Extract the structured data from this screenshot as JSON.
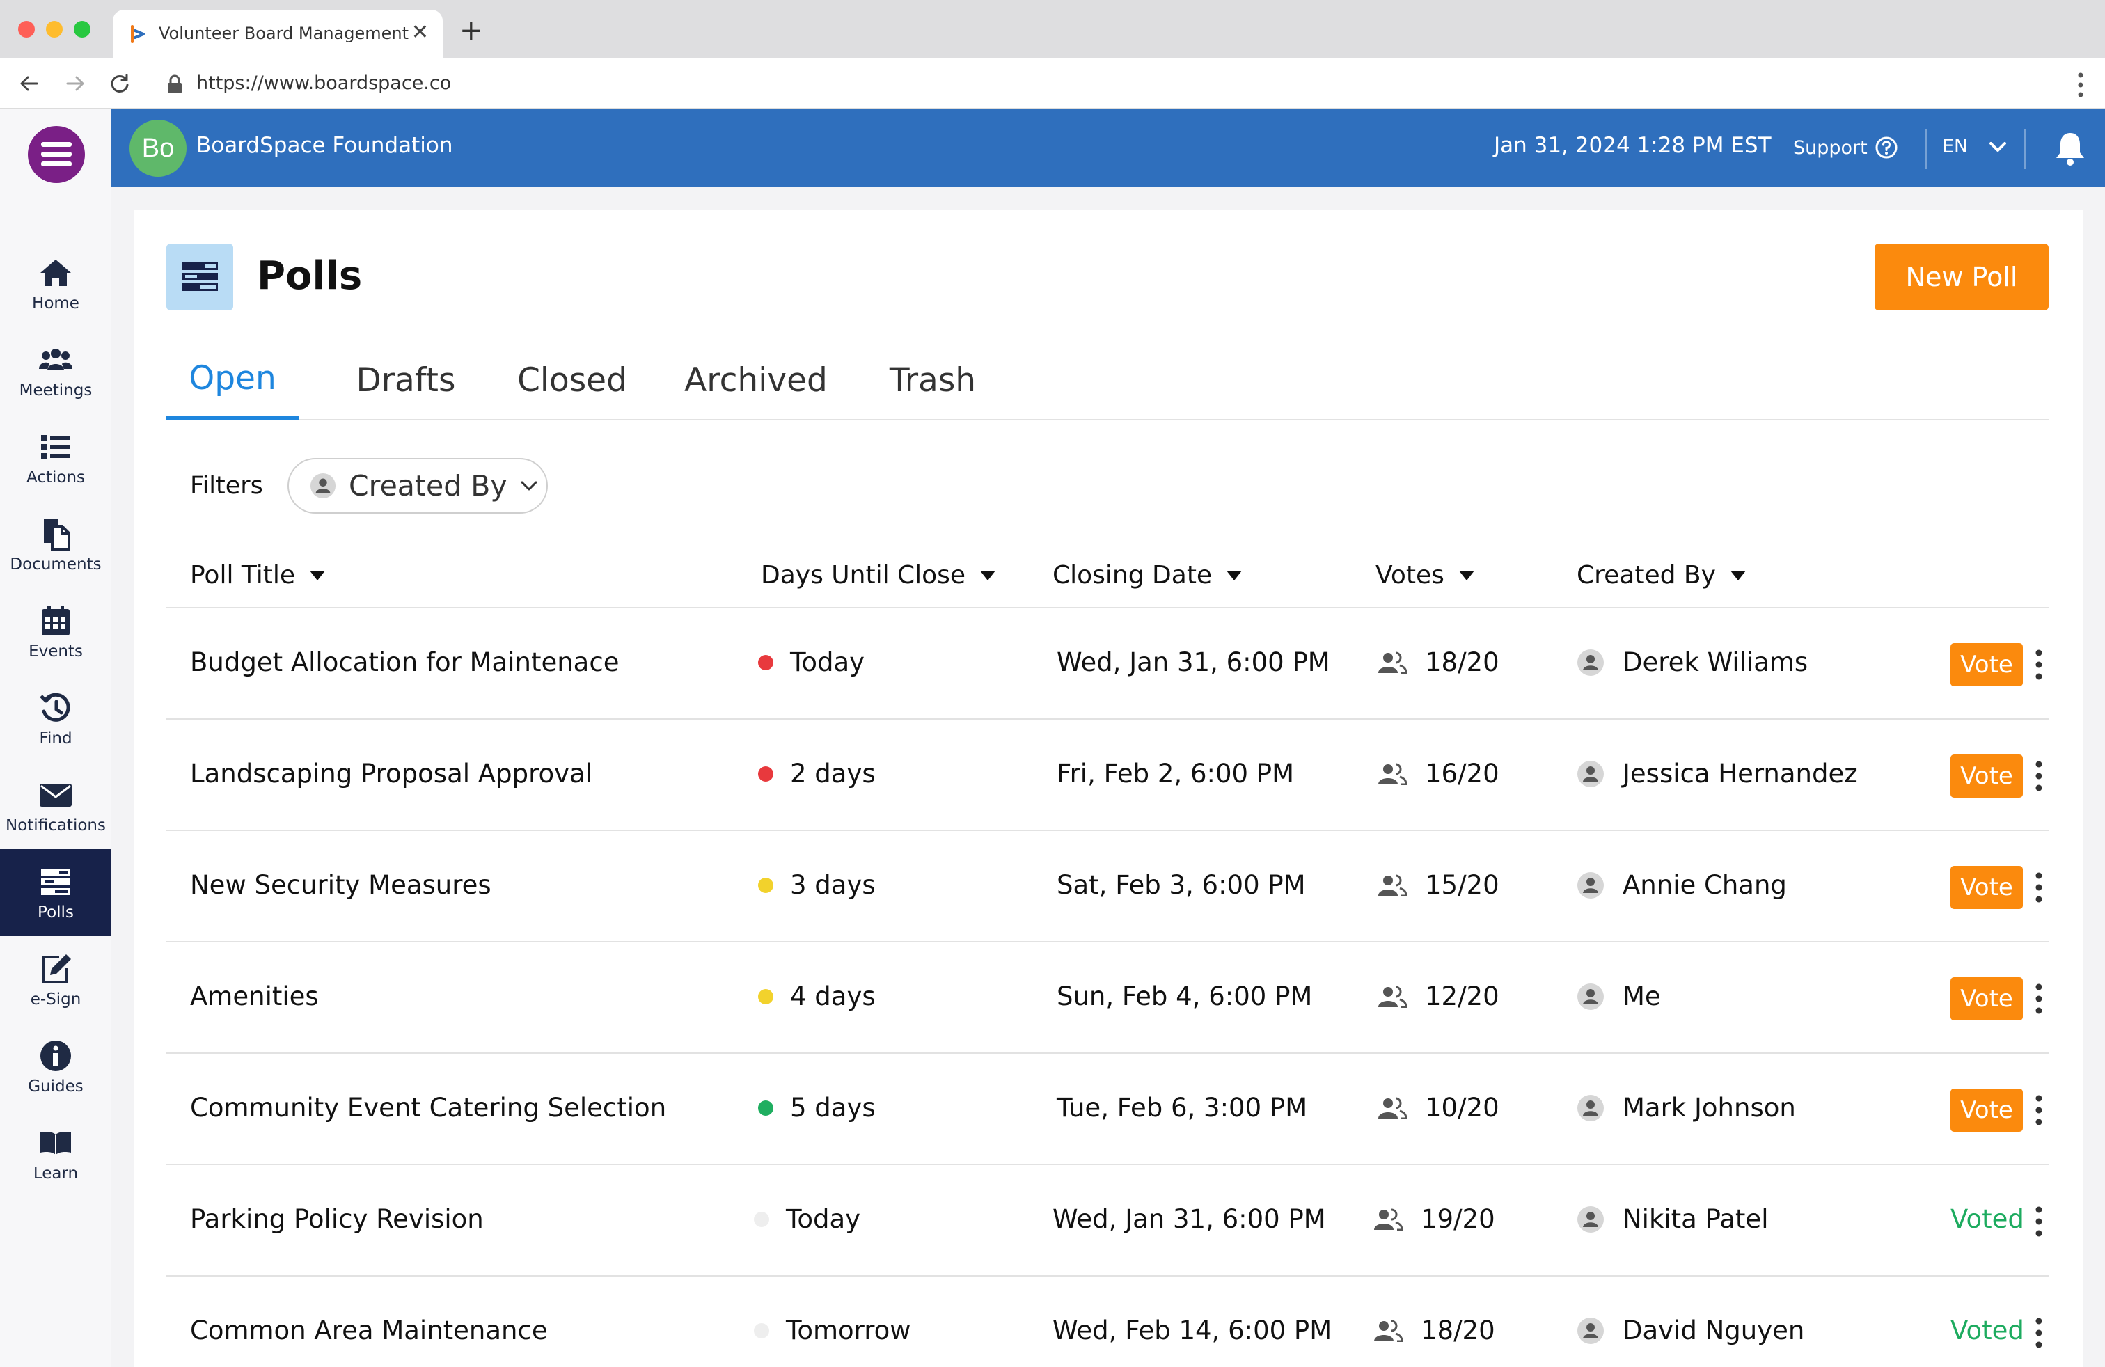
{
  "browser": {
    "tab_title": "Volunteer Board Management",
    "url": "https://www.boardspace.co",
    "icons": [
      "favicon-icon",
      "close-tab-icon",
      "new-tab-icon",
      "back-icon",
      "forward-icon",
      "reload-icon",
      "lock-icon",
      "browser-menu-icon"
    ]
  },
  "sidebar": {
    "menu_icon": "hamburger-icon",
    "items": [
      {
        "label": "Home",
        "icon": "home-icon"
      },
      {
        "label": "Meetings",
        "icon": "people-group-icon"
      },
      {
        "label": "Actions",
        "icon": "list-icon"
      },
      {
        "label": "Documents",
        "icon": "documents-icon"
      },
      {
        "label": "Events",
        "icon": "calendar-icon"
      },
      {
        "label": "Find",
        "icon": "history-icon"
      },
      {
        "label": "Notifications",
        "icon": "envelope-icon"
      },
      {
        "label": "Polls",
        "icon": "polls-icon",
        "active": true
      },
      {
        "label": "e-Sign",
        "icon": "edit-icon"
      },
      {
        "label": "Guides",
        "icon": "info-icon"
      },
      {
        "label": "Learn",
        "icon": "book-icon"
      }
    ]
  },
  "header": {
    "org_initials": "Bo",
    "org_name": "BoardSpace Foundation",
    "datetime": "Jan 31, 2024 1:28 PM  EST",
    "support_label": "Support",
    "language": "EN"
  },
  "page": {
    "title": "Polls",
    "new_poll_label": "New Poll",
    "tabs": [
      "Open",
      "Drafts",
      "Closed",
      "Archived",
      "Trash"
    ],
    "active_tab": "Open",
    "filters_label": "Filters",
    "filter_created_by": "Created By"
  },
  "table": {
    "columns": [
      "Poll Title",
      "Days Until Close",
      "Closing Date",
      "Votes",
      "Created By"
    ],
    "rows": [
      {
        "title": "Budget Allocation for Maintenace",
        "days": "Today",
        "status_color": "#e8393d",
        "closing": "Wed, Jan 31, 6:00 PM",
        "votes": "18/20",
        "creator": "Derek Wiliams",
        "action": "Vote"
      },
      {
        "title": "Landscaping Proposal Approval",
        "days": "2 days",
        "status_color": "#e8393d",
        "closing": "Fri, Feb 2, 6:00 PM",
        "votes": "16/20",
        "creator": "Jessica Hernandez",
        "action": "Vote"
      },
      {
        "title": "New Security Measures",
        "days": "3 days",
        "status_color": "#f2d22c",
        "closing": "Sat, Feb 3, 6:00 PM",
        "votes": "15/20",
        "creator": "Annie Chang",
        "action": "Vote"
      },
      {
        "title": "Amenities",
        "days": "4 days",
        "status_color": "#f2d22c",
        "closing": "Sun, Feb 4, 6:00 PM",
        "votes": "12/20",
        "creator": "Me",
        "action": "Vote"
      },
      {
        "title": "Community Event Catering Selection",
        "days": "5 days",
        "status_color": "#1fae60",
        "closing": "Tue, Feb 6, 3:00 PM",
        "votes": "10/20",
        "creator": "Mark Johnson",
        "action": "Vote"
      },
      {
        "title": "Parking Policy Revision",
        "days": "Today",
        "status_color": "#eeeeee",
        "closing": "Wed, Jan 31, 6:00 PM",
        "votes": "19/20",
        "creator": "Nikita Patel",
        "action": "Voted"
      },
      {
        "title": "Common Area Maintenance",
        "days": "Tomorrow",
        "status_color": "#eeeeee",
        "closing": "Wed, Feb 14, 6:00 PM",
        "votes": "18/20",
        "creator": "David Nguyen",
        "action": "Voted"
      }
    ]
  },
  "colors": {
    "header_blue": "#2f6fbd",
    "accent_orange": "#fb8a0d",
    "active_tab_blue": "#1e86de",
    "sidebar_active": "#17224a",
    "voted_green": "#1dab5f",
    "menu_purple": "#7a1f86"
  }
}
